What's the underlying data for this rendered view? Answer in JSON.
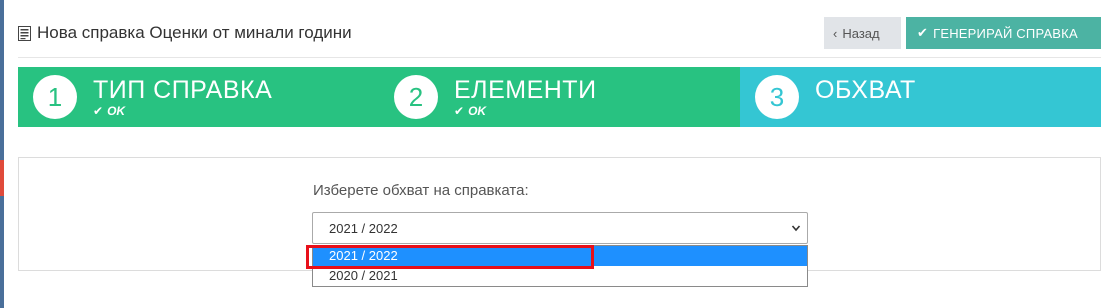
{
  "header": {
    "title": "Нова справка Оценки от минали години",
    "back_label": "Назад",
    "generate_label": "ГЕНЕРИРАЙ СПРАВКА"
  },
  "steps": [
    {
      "number": "1",
      "title": "ТИП СПРАВКА",
      "status": "OK"
    },
    {
      "number": "2",
      "title": "ЕЛЕМЕНТИ",
      "status": "OK"
    },
    {
      "number": "3",
      "title": "ОБХВАТ"
    }
  ],
  "scope": {
    "label": "Изберете обхват на справката:",
    "selected_value": "2021 / 2022",
    "options": [
      "2021 / 2022",
      "2020 / 2021"
    ]
  },
  "colors": {
    "step_done": "#28c281",
    "step_active": "#34c6d3",
    "generate_button": "#4cb3a3",
    "option_highlight": "#1e90ff",
    "annotation_box": "#e8101a"
  }
}
